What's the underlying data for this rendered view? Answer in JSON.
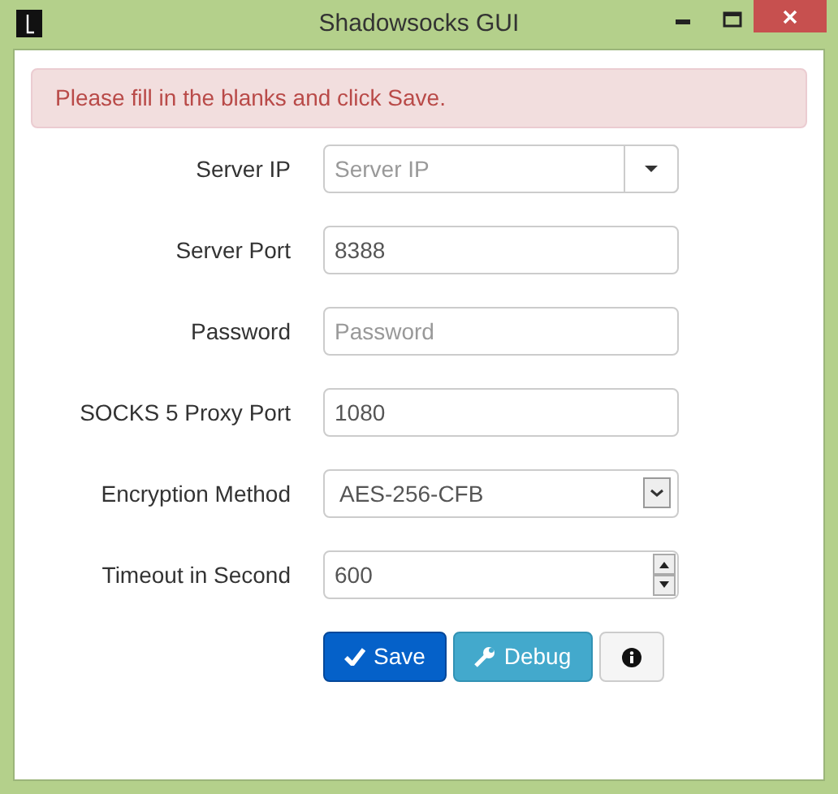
{
  "window": {
    "title": "Shadowsocks GUI"
  },
  "alert": {
    "message": "Please fill in the blanks and click Save."
  },
  "fields": [
    {
      "label": "Server IP",
      "kind": "combo",
      "placeholder": "Server IP"
    },
    {
      "label": "Server Port",
      "kind": "text",
      "value": "8388"
    },
    {
      "label": "Password",
      "kind": "text",
      "placeholder": "Password"
    },
    {
      "label": "SOCKS 5 Proxy Port",
      "kind": "text",
      "value": "1080"
    },
    {
      "label": "Encryption Method",
      "kind": "select",
      "value": "AES-256-CFB"
    },
    {
      "label": "Timeout in Second",
      "kind": "number",
      "value": "600"
    }
  ],
  "buttons": [
    {
      "kind": "primary",
      "label": "Save"
    },
    {
      "kind": "info",
      "label": "Debug"
    },
    {
      "kind": "default"
    }
  ]
}
